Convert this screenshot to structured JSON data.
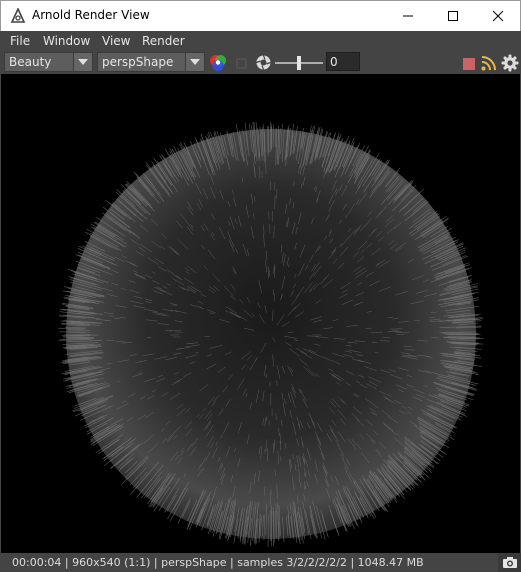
{
  "window": {
    "title": "Arnold Render View"
  },
  "menu": {
    "items": [
      "File",
      "Window",
      "View",
      "Render"
    ]
  },
  "toolbar": {
    "aov_value": "Beauty",
    "camera_value": "perspShape",
    "exposure_value": "0",
    "exposure_level": 0.5
  },
  "status": {
    "text": "00:00:04 | 960x540 (1:1) | perspShape  | samples 3/2/2/2/2/2 | 1048.47 MB"
  },
  "colors": {
    "stop_button": "#c86464",
    "background": "#444444"
  },
  "icons": [
    "arnold-logo-icon",
    "minimize-icon",
    "maximize-icon",
    "close-icon",
    "chevron-down-icon",
    "rgb-channels-icon",
    "region-icon",
    "aperture-icon",
    "stop-icon",
    "ipr-icon",
    "gear-icon",
    "camera-icon"
  ]
}
